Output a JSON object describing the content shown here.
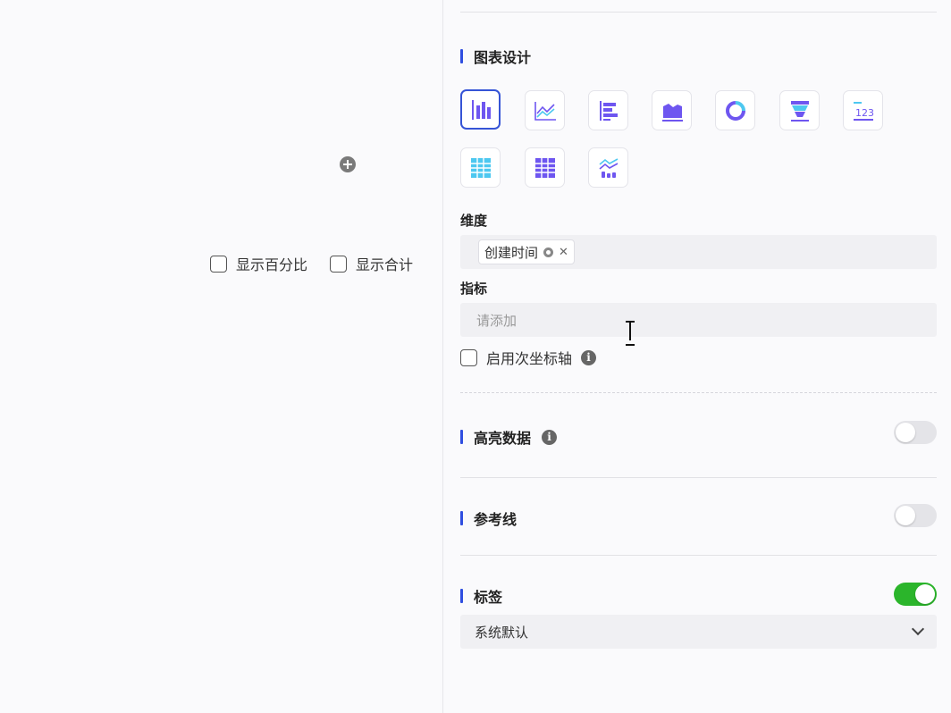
{
  "left_panel": {
    "show_percent_label": "显示百分比",
    "show_total_label": "显示合计"
  },
  "chart_design": {
    "title": "图表设计",
    "chart_types": [
      {
        "icon": "column-chart-icon",
        "selected": true
      },
      {
        "icon": "line-chart-icon",
        "selected": false
      },
      {
        "icon": "bar-chart-icon",
        "selected": false
      },
      {
        "icon": "area-chart-icon",
        "selected": false
      },
      {
        "icon": "donut-chart-icon",
        "selected": false
      },
      {
        "icon": "funnel-chart-icon",
        "selected": false
      },
      {
        "icon": "statistic-number-icon",
        "selected": false
      },
      {
        "icon": "table-icon",
        "selected": false
      },
      {
        "icon": "pivot-table-icon",
        "selected": false
      },
      {
        "icon": "combo-chart-icon",
        "selected": false
      }
    ]
  },
  "dimension": {
    "label": "维度",
    "tag": "创建时间"
  },
  "metric": {
    "label": "指标",
    "placeholder": "请添加"
  },
  "secondary_axis": {
    "label": "启用次坐标轴",
    "checked": false
  },
  "highlight": {
    "title": "高亮数据",
    "enabled": false
  },
  "reference_line": {
    "title": "参考线",
    "enabled": false
  },
  "data_label": {
    "title": "标签",
    "enabled": true,
    "select_value": "系统默认"
  },
  "colors": {
    "accent": "#2f4ee0",
    "toggle_on": "#2bb52b",
    "chart_purple": "#6e56f0",
    "chart_cyan": "#4dc8f0"
  }
}
